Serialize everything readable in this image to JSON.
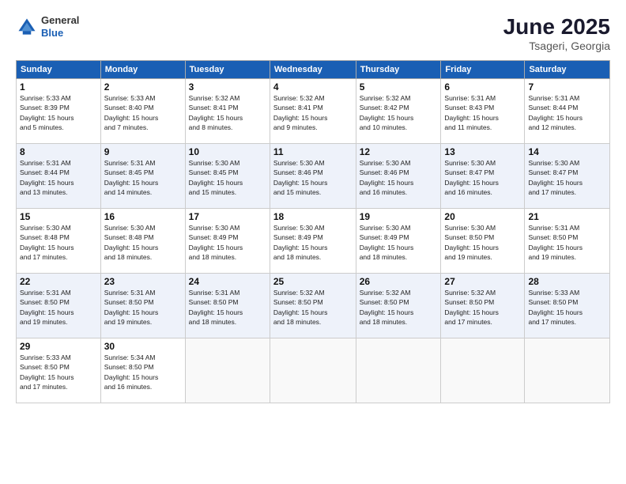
{
  "logo": {
    "general": "General",
    "blue": "Blue"
  },
  "title": {
    "month": "June 2025",
    "location": "Tsageri, Georgia"
  },
  "weekdays": [
    "Sunday",
    "Monday",
    "Tuesday",
    "Wednesday",
    "Thursday",
    "Friday",
    "Saturday"
  ],
  "weeks": [
    [
      {
        "day": "1",
        "info": "Sunrise: 5:33 AM\nSunset: 8:39 PM\nDaylight: 15 hours\nand 5 minutes."
      },
      {
        "day": "2",
        "info": "Sunrise: 5:33 AM\nSunset: 8:40 PM\nDaylight: 15 hours\nand 7 minutes."
      },
      {
        "day": "3",
        "info": "Sunrise: 5:32 AM\nSunset: 8:41 PM\nDaylight: 15 hours\nand 8 minutes."
      },
      {
        "day": "4",
        "info": "Sunrise: 5:32 AM\nSunset: 8:41 PM\nDaylight: 15 hours\nand 9 minutes."
      },
      {
        "day": "5",
        "info": "Sunrise: 5:32 AM\nSunset: 8:42 PM\nDaylight: 15 hours\nand 10 minutes."
      },
      {
        "day": "6",
        "info": "Sunrise: 5:31 AM\nSunset: 8:43 PM\nDaylight: 15 hours\nand 11 minutes."
      },
      {
        "day": "7",
        "info": "Sunrise: 5:31 AM\nSunset: 8:44 PM\nDaylight: 15 hours\nand 12 minutes."
      }
    ],
    [
      {
        "day": "8",
        "info": "Sunrise: 5:31 AM\nSunset: 8:44 PM\nDaylight: 15 hours\nand 13 minutes."
      },
      {
        "day": "9",
        "info": "Sunrise: 5:31 AM\nSunset: 8:45 PM\nDaylight: 15 hours\nand 14 minutes."
      },
      {
        "day": "10",
        "info": "Sunrise: 5:30 AM\nSunset: 8:45 PM\nDaylight: 15 hours\nand 15 minutes."
      },
      {
        "day": "11",
        "info": "Sunrise: 5:30 AM\nSunset: 8:46 PM\nDaylight: 15 hours\nand 15 minutes."
      },
      {
        "day": "12",
        "info": "Sunrise: 5:30 AM\nSunset: 8:46 PM\nDaylight: 15 hours\nand 16 minutes."
      },
      {
        "day": "13",
        "info": "Sunrise: 5:30 AM\nSunset: 8:47 PM\nDaylight: 15 hours\nand 16 minutes."
      },
      {
        "day": "14",
        "info": "Sunrise: 5:30 AM\nSunset: 8:47 PM\nDaylight: 15 hours\nand 17 minutes."
      }
    ],
    [
      {
        "day": "15",
        "info": "Sunrise: 5:30 AM\nSunset: 8:48 PM\nDaylight: 15 hours\nand 17 minutes."
      },
      {
        "day": "16",
        "info": "Sunrise: 5:30 AM\nSunset: 8:48 PM\nDaylight: 15 hours\nand 18 minutes."
      },
      {
        "day": "17",
        "info": "Sunrise: 5:30 AM\nSunset: 8:49 PM\nDaylight: 15 hours\nand 18 minutes."
      },
      {
        "day": "18",
        "info": "Sunrise: 5:30 AM\nSunset: 8:49 PM\nDaylight: 15 hours\nand 18 minutes."
      },
      {
        "day": "19",
        "info": "Sunrise: 5:30 AM\nSunset: 8:49 PM\nDaylight: 15 hours\nand 18 minutes."
      },
      {
        "day": "20",
        "info": "Sunrise: 5:30 AM\nSunset: 8:50 PM\nDaylight: 15 hours\nand 19 minutes."
      },
      {
        "day": "21",
        "info": "Sunrise: 5:31 AM\nSunset: 8:50 PM\nDaylight: 15 hours\nand 19 minutes."
      }
    ],
    [
      {
        "day": "22",
        "info": "Sunrise: 5:31 AM\nSunset: 8:50 PM\nDaylight: 15 hours\nand 19 minutes."
      },
      {
        "day": "23",
        "info": "Sunrise: 5:31 AM\nSunset: 8:50 PM\nDaylight: 15 hours\nand 19 minutes."
      },
      {
        "day": "24",
        "info": "Sunrise: 5:31 AM\nSunset: 8:50 PM\nDaylight: 15 hours\nand 18 minutes."
      },
      {
        "day": "25",
        "info": "Sunrise: 5:32 AM\nSunset: 8:50 PM\nDaylight: 15 hours\nand 18 minutes."
      },
      {
        "day": "26",
        "info": "Sunrise: 5:32 AM\nSunset: 8:50 PM\nDaylight: 15 hours\nand 18 minutes."
      },
      {
        "day": "27",
        "info": "Sunrise: 5:32 AM\nSunset: 8:50 PM\nDaylight: 15 hours\nand 17 minutes."
      },
      {
        "day": "28",
        "info": "Sunrise: 5:33 AM\nSunset: 8:50 PM\nDaylight: 15 hours\nand 17 minutes."
      }
    ],
    [
      {
        "day": "29",
        "info": "Sunrise: 5:33 AM\nSunset: 8:50 PM\nDaylight: 15 hours\nand 17 minutes."
      },
      {
        "day": "30",
        "info": "Sunrise: 5:34 AM\nSunset: 8:50 PM\nDaylight: 15 hours\nand 16 minutes."
      },
      {
        "day": "",
        "info": ""
      },
      {
        "day": "",
        "info": ""
      },
      {
        "day": "",
        "info": ""
      },
      {
        "day": "",
        "info": ""
      },
      {
        "day": "",
        "info": ""
      }
    ]
  ]
}
